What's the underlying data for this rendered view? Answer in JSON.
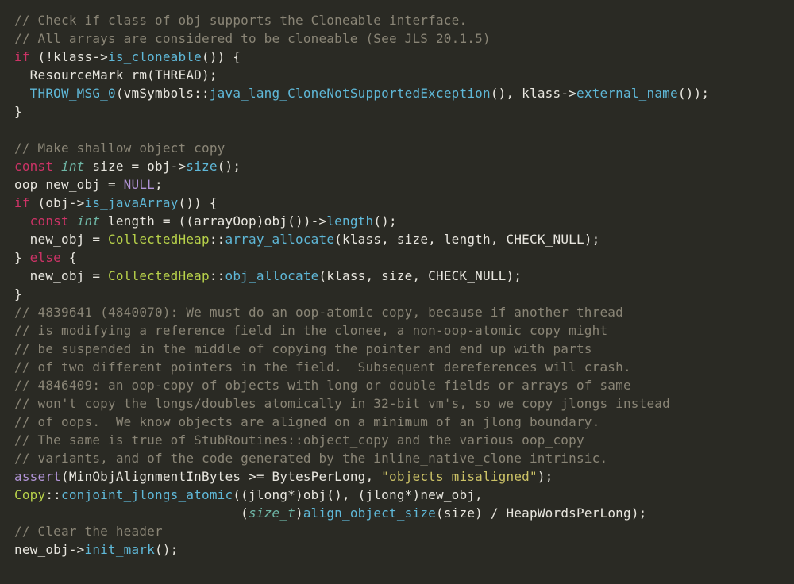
{
  "code": {
    "c1": "// Check if class of obj supports the Cloneable interface.",
    "c2": "// All arrays are considered to be cloneable (See JLS 20.1.5)",
    "kw_if1": "if",
    "l3a": " (!klass->",
    "l3fn": "is_cloneable",
    "l3b": "()) {",
    "l4": "  ResourceMark rm(THREAD);",
    "l5a": "  ",
    "l5fn": "THROW_MSG_0",
    "l5b": "(vmSymbols::",
    "l5fn2": "java_lang_CloneNotSupportedException",
    "l5c": "(), klass->",
    "l5fn3": "external_name",
    "l5d": "());",
    "rb1": "}",
    "c7": "// Make shallow object copy",
    "kw_const1": "const",
    "ty_int1": "int",
    "l8a": " size = obj->",
    "l8fn": "size",
    "l8b": "();",
    "l9a": "oop new_obj = ",
    "null": "NULL",
    "l9b": ";",
    "kw_if2": "if",
    "l10a": " (obj->",
    "l10fn": "is_javaArray",
    "l10b": "()) {",
    "kw_const2": "const",
    "ty_int2": "int",
    "l11a": " length = ((arrayOop)obj())->",
    "l11fn": "length",
    "l11b": "();",
    "l12a": "  new_obj = ",
    "cls_ch": "CollectedHeap",
    "l12b": "::",
    "l12fn": "array_allocate",
    "l12c": "(klass, size, length, CHECK_NULL);",
    "l13a": "} ",
    "kw_else": "else",
    "l13b": " {",
    "l14a": "  new_obj = ",
    "l14b": "::",
    "l14fn": "obj_allocate",
    "l14c": "(klass, size, CHECK_NULL);",
    "rb2": "}",
    "c16": "// 4839641 (4840070): We must do an oop-atomic copy, because if another thread",
    "c17": "// is modifying a reference field in the clonee, a non-oop-atomic copy might",
    "c18": "// be suspended in the middle of copying the pointer and end up with parts",
    "c19": "// of two different pointers in the field.  Subsequent dereferences will crash.",
    "c20": "// 4846409: an oop-copy of objects with long or double fields or arrays of same",
    "c21": "// won't copy the longs/doubles atomically in 32-bit vm's, so we copy jlongs instead",
    "c22": "// of oops.  We know objects are aligned on a minimum of an jlong boundary.",
    "c23": "// The same is true of StubRoutines::object_copy and the various oop_copy",
    "c24": "// variants, and of the code generated by the inline_native_clone intrinsic.",
    "assert": "assert",
    "l25a": "(MinObjAlignmentInBytes >= BytesPerLong, ",
    "str1": "\"objects misaligned\"",
    "l25b": ");",
    "cls_copy": "Copy",
    "l26a": "::",
    "l26fn": "conjoint_jlongs_atomic",
    "l26b": "((jlong*)obj(), (jlong*)new_obj,",
    "l27a": "                             (",
    "ty_sizet": "size_t",
    "l27b": ")",
    "l27fn": "align_object_size",
    "l27c": "(size) / HeapWordsPerLong);",
    "c28": "// Clear the header",
    "l29a": "new_obj->",
    "l29fn": "init_mark",
    "l29b": "();"
  }
}
